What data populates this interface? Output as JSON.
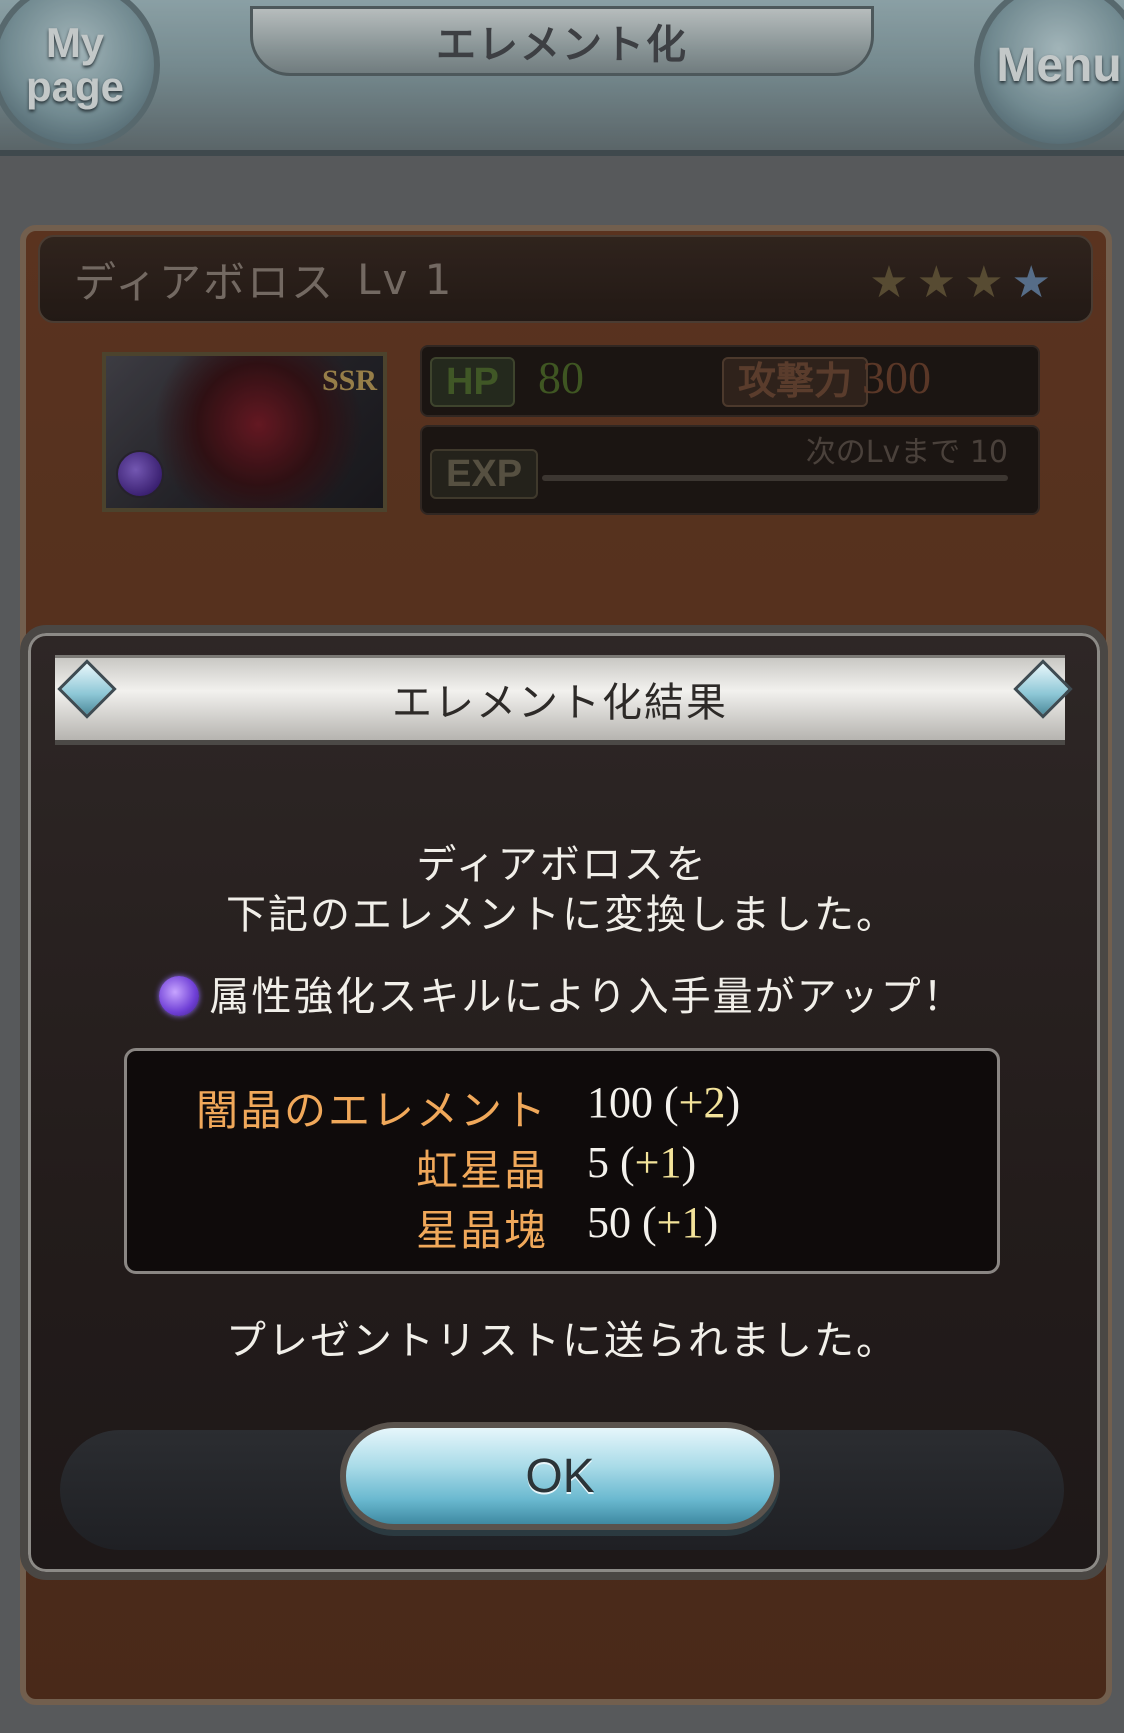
{
  "header": {
    "title": "エレメント化",
    "mypage_label": "My page",
    "menu_label": "Menu"
  },
  "summon": {
    "name": "ディアボロス",
    "level": "Lv 1",
    "stars": {
      "filled": 1,
      "total": 4
    },
    "rarity": "SSR",
    "hp_tag": "HP",
    "hp": "80",
    "atk_tag": "攻撃力",
    "atk": "300",
    "exp_tag": "EXP",
    "next_level_label": "次のLvまで",
    "next_level_value": "10",
    "exp_progress": 0.0
  },
  "modal": {
    "title": "エレメント化結果",
    "message_line1": "ディアボロスを",
    "message_line2": "下記のエレメントに変換しました。",
    "bonus_text": "属性強化スキルにより入手量がアップ！",
    "results": [
      {
        "name": "闇晶のエレメント",
        "value": "100 (",
        "bonus": "+2",
        "close": ")"
      },
      {
        "name": "虹星晶",
        "value": "5 (",
        "bonus": "+1",
        "close": ")"
      },
      {
        "name": "星晶塊",
        "value": "50 (",
        "bonus": "+1",
        "close": ")"
      }
    ],
    "sent_text": "プレゼントリストに送られました。",
    "ok_label": "OK"
  },
  "colors": {
    "result_name": "#f0a85a",
    "result_bonus": "#f3e39a",
    "panel_brown": "#5a331f",
    "ok_button": "#69b8cf"
  }
}
